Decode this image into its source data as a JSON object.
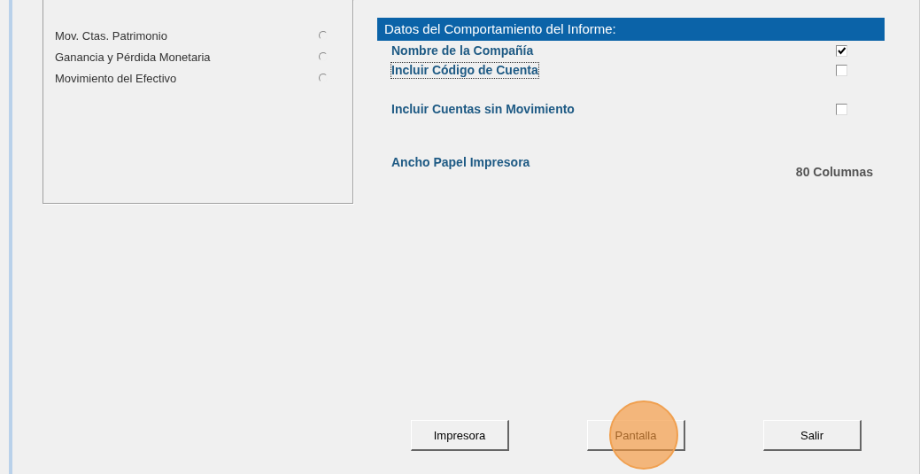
{
  "report_types": [
    {
      "label": "Mov. Ctas. Patrimonio",
      "selected": false
    },
    {
      "label": "Ganancia y Pérdida Monetaria",
      "selected": false
    },
    {
      "label": "Movimiento del Efectivo",
      "selected": false
    }
  ],
  "options_panel": {
    "title": "Datos del Comportamiento del Informe:",
    "checkboxes": [
      {
        "label": "Nombre de la Compañía",
        "checked": true,
        "focused": false
      },
      {
        "label": "Incluir Código de Cuenta",
        "checked": false,
        "focused": true
      },
      {
        "label": "Incluir Cuentas sin Movimiento",
        "checked": false,
        "focused": false
      }
    ],
    "paper_width": {
      "label": "Ancho Papel Impresora",
      "value": "80 Columnas"
    }
  },
  "buttons": [
    {
      "label": "Impresora",
      "highlighted": false
    },
    {
      "label": "Pantalla",
      "highlighted": true
    },
    {
      "label": "Salir",
      "highlighted": false
    }
  ]
}
